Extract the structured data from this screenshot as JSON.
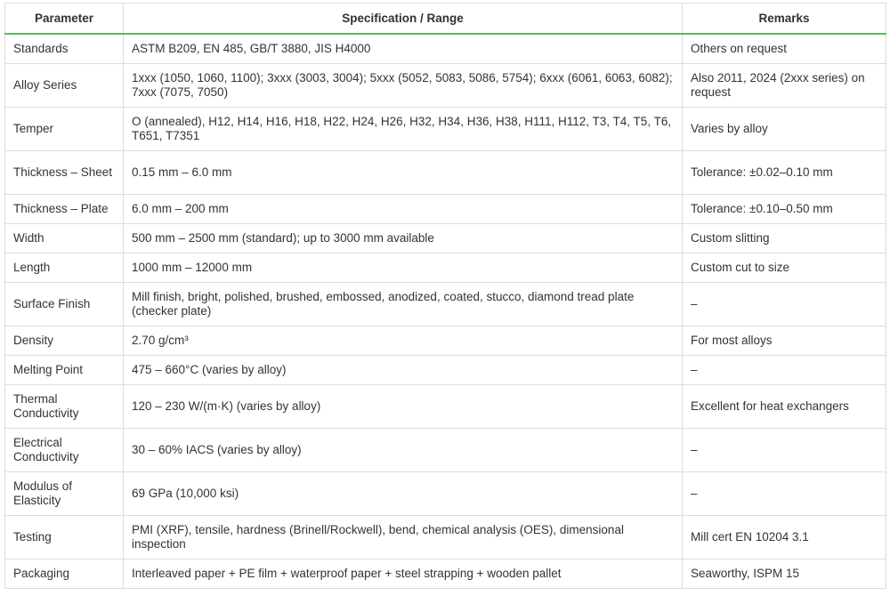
{
  "headers": {
    "parameter": "Parameter",
    "specification": "Specification / Range",
    "remarks": "Remarks"
  },
  "rows": [
    {
      "parameter": "Standards",
      "specification": "ASTM B209, EN 485, GB/T 3880, JIS H4000",
      "remarks": "Others on request"
    },
    {
      "parameter": "Alloy Series",
      "specification": "1xxx (1050, 1060, 1100); 3xxx (3003, 3004); 5xxx (5052, 5083, 5086, 5754); 6xxx (6061, 6063, 6082); 7xxx (7075, 7050)",
      "remarks": "Also 2011, 2024 (2xxx series) on request"
    },
    {
      "parameter": "Temper",
      "specification": "O (annealed), H12, H14, H16, H18, H22, H24, H26, H32, H34, H36, H38, H111, H112, T3, T4, T5, T6, T651, T7351",
      "remarks": "Varies by alloy"
    },
    {
      "parameter": "Thickness – Sheet",
      "specification": "0.15 mm – 6.0 mm",
      "remarks": "Tolerance: ±0.02–0.10 mm"
    },
    {
      "parameter": "Thickness – Plate",
      "specification": "6.0 mm – 200 mm",
      "remarks": "Tolerance: ±0.10–0.50 mm"
    },
    {
      "parameter": "Width",
      "specification": "500 mm – 2500 mm (standard); up to 3000 mm available",
      "remarks": "Custom slitting"
    },
    {
      "parameter": "Length",
      "specification": "1000 mm – 12000 mm",
      "remarks": "Custom cut to size"
    },
    {
      "parameter": "Surface Finish",
      "specification": "Mill finish, bright, polished, brushed, embossed, anodized, coated, stucco, diamond tread plate (checker plate)",
      "remarks": "–"
    },
    {
      "parameter": "Density",
      "specification": "2.70 g/cm³",
      "remarks": "For most alloys"
    },
    {
      "parameter": "Melting Point",
      "specification": "475 – 660°C (varies by alloy)",
      "remarks": "–"
    },
    {
      "parameter": "Thermal Conductivity",
      "specification": "120 – 230 W/(m·K) (varies by alloy)",
      "remarks": "Excellent for heat exchangers"
    },
    {
      "parameter": "Electrical Conductivity",
      "specification": "30 – 60% IACS (varies by alloy)",
      "remarks": "–"
    },
    {
      "parameter": "Modulus of Elasticity",
      "specification": "69 GPa (10,000 ksi)",
      "remarks": "–"
    },
    {
      "parameter": "Testing",
      "specification": "PMI (XRF), tensile, hardness (Brinell/Rockwell), bend, chemical analysis (OES), dimensional inspection",
      "remarks": "Mill cert EN 10204 3.1"
    },
    {
      "parameter": "Packaging",
      "specification": "Interleaved paper + PE film + waterproof paper + steel strapping + wooden pallet",
      "remarks": "Seaworthy, ISPM 15"
    }
  ],
  "colors": {
    "header_underline": "#5cb85c",
    "border": "#dcdcdc",
    "text": "#333333"
  }
}
